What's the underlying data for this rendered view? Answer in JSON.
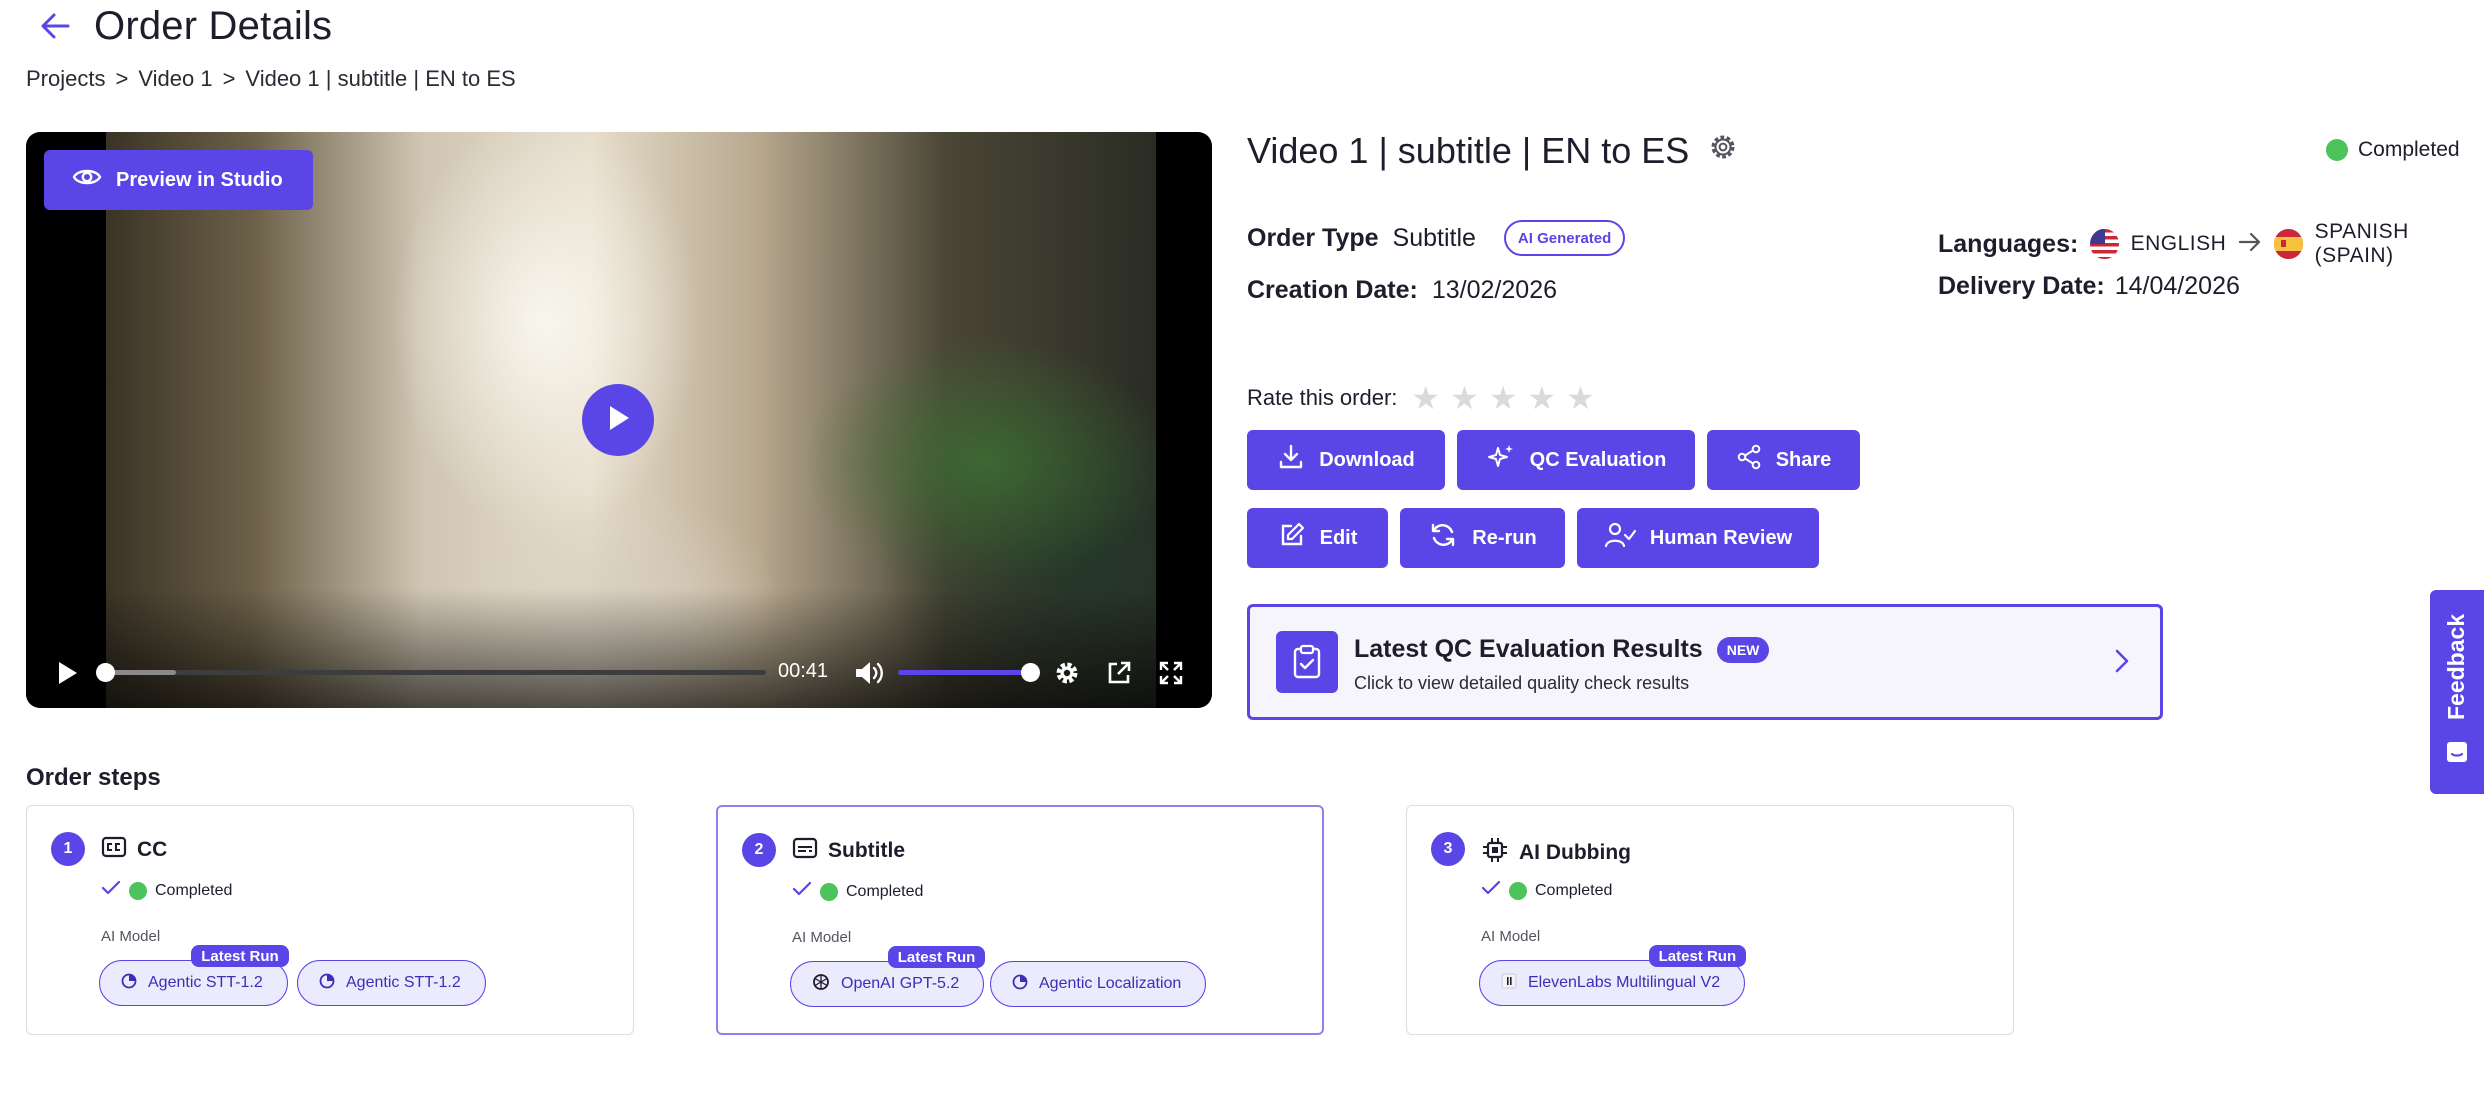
{
  "header": {
    "title": "Order Details"
  },
  "breadcrumb": {
    "items": [
      "Projects",
      ">",
      "Video 1",
      ">",
      "Video 1 | subtitle | EN to ES"
    ]
  },
  "video": {
    "preview_label": "Preview in Studio",
    "time": "00:41",
    "progress": 0.0,
    "volume": 1.0
  },
  "order": {
    "title": "Video 1 | subtitle | EN to ES",
    "status": "Completed",
    "type_label": "Order Type",
    "type_value": "Subtitle",
    "type_badge": "AI Generated",
    "creation_label": "Creation Date:",
    "creation_value": "13/02/2026",
    "languages_label": "Languages:",
    "source_language": "ENGLISH",
    "target_language": "SPANISH (SPAIN)",
    "delivery_label": "Delivery Date:",
    "delivery_value": "14/04/2026"
  },
  "rating": {
    "label": "Rate this order:",
    "value": 0,
    "max": 5
  },
  "actions": {
    "download": "Download",
    "qc_evaluation": "QC Evaluation",
    "share": "Share",
    "edit": "Edit",
    "rerun": "Re-run",
    "human_review": "Human Review"
  },
  "qc_card": {
    "title": "Latest QC Evaluation Results",
    "badge": "NEW",
    "subtitle": "Click to view detailed quality check results"
  },
  "feedback": {
    "label": "Feedback"
  },
  "steps": {
    "section_title": "Order steps",
    "ai_model_label": "AI Model",
    "latest_run_label": "Latest Run",
    "items": [
      {
        "number": "1",
        "name": "CC",
        "status": "Completed",
        "models": [
          "Agentic STT-1.2",
          "Agentic STT-1.2"
        ]
      },
      {
        "number": "2",
        "name": "Subtitle",
        "status": "Completed",
        "models": [
          "OpenAI GPT-5.2",
          "Agentic Localization"
        ]
      },
      {
        "number": "3",
        "name": "AI Dubbing",
        "status": "Completed",
        "models": [
          "ElevenLabs Multilingual V2"
        ]
      }
    ]
  },
  "colors": {
    "accent": "#5a45e6",
    "success": "#4cc35b",
    "text": "#1f1d2b"
  }
}
